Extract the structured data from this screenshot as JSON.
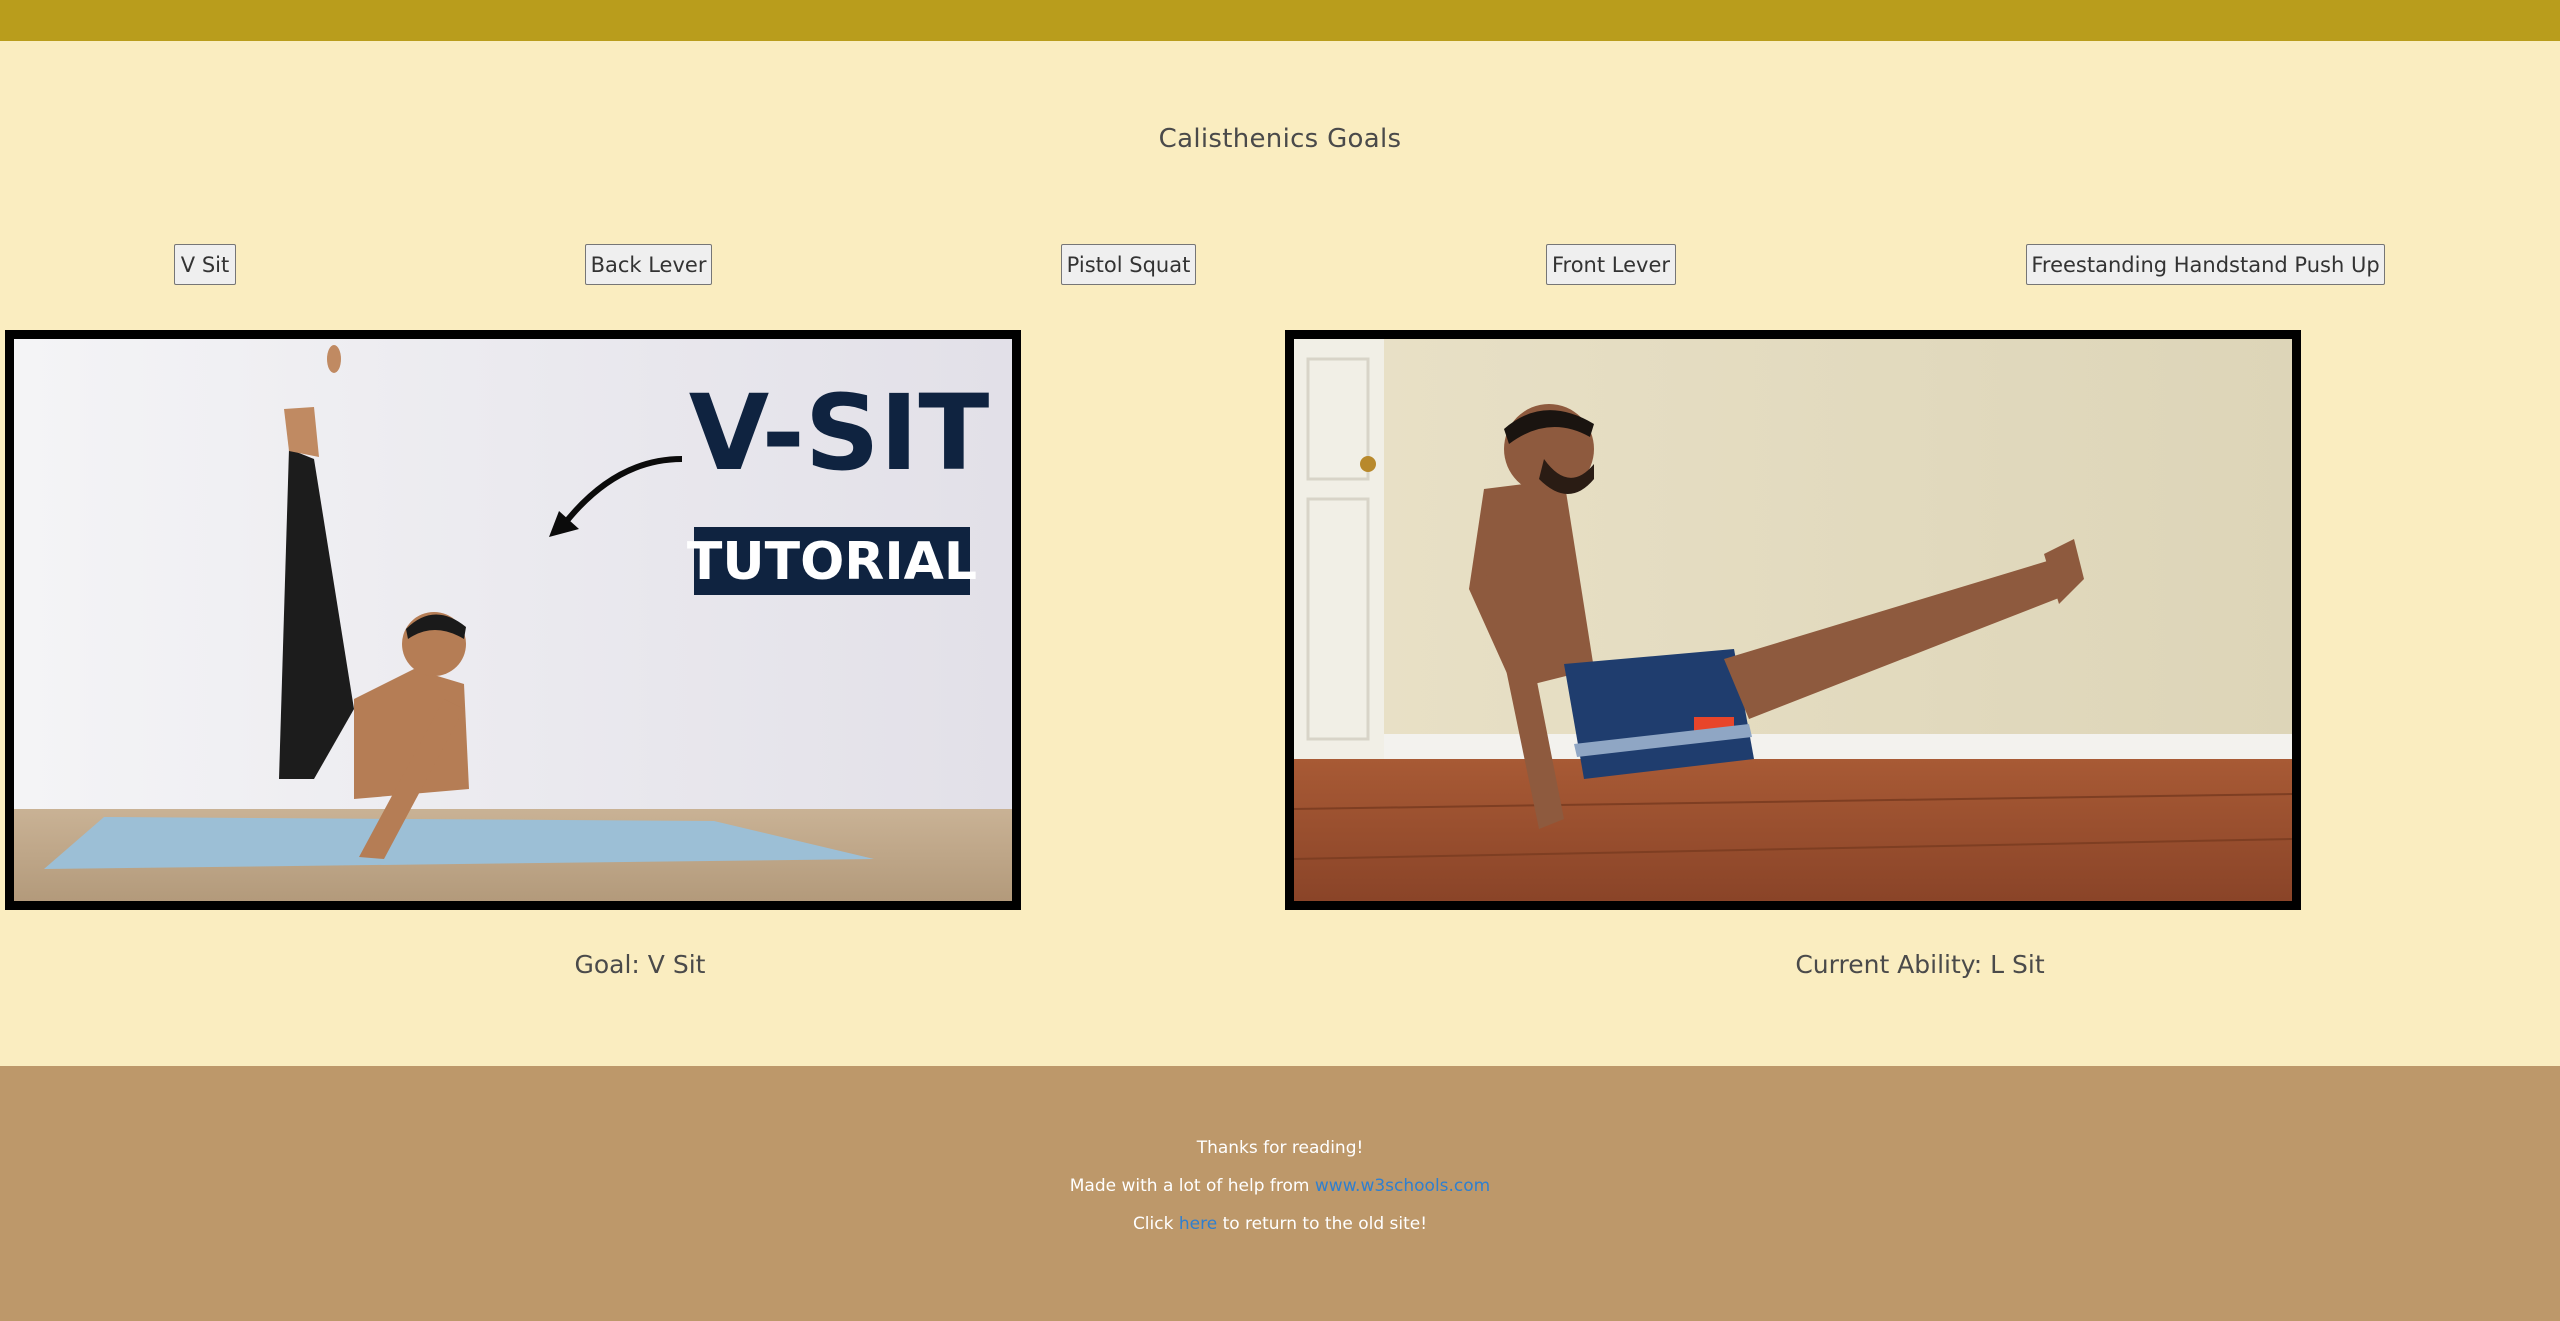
{
  "header": {
    "title": "Calisthenics Goals",
    "bar_color": "#B99D1C"
  },
  "goals": [
    {
      "label": "V Sit"
    },
    {
      "label": "Back Lever"
    },
    {
      "label": "Pistol Squat"
    },
    {
      "label": "Front Lever"
    },
    {
      "label": "Freestanding Handstand Push Up"
    }
  ],
  "images": {
    "left": {
      "headline": "V-SIT",
      "subline": "TUTORIAL"
    },
    "right": {}
  },
  "captions": {
    "goal": "Goal: V Sit",
    "current": "Current Ability: L Sit"
  },
  "footer": {
    "thanks": "Thanks for reading!",
    "made_prefix": "Made with a lot of help from ",
    "made_link": "www.w3schools.com",
    "click_prefix": "Click ",
    "click_link": "here",
    "click_suffix": " to return to the old site!"
  },
  "colors": {
    "page_bg": "#FAEDC0",
    "footer_bg": "#BD986A",
    "link": "#2F7FCF"
  }
}
